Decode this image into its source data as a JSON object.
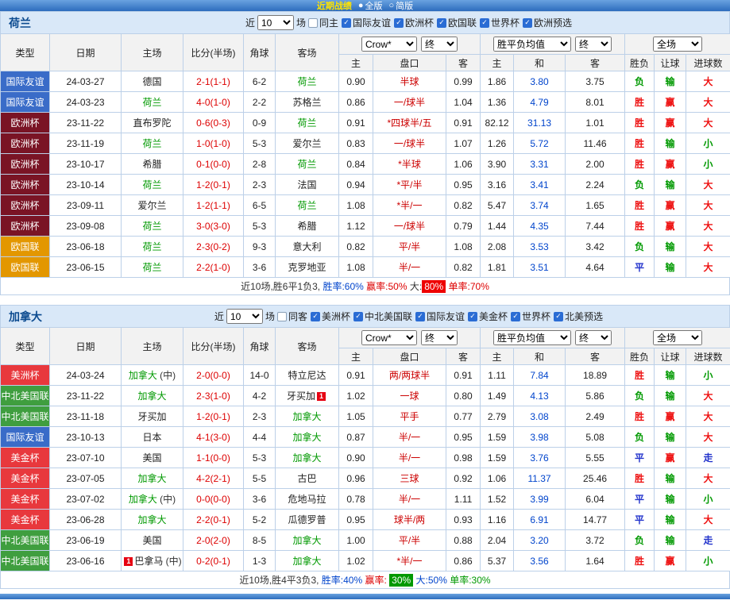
{
  "topbar": {
    "title": "近期战绩",
    "options": [
      {
        "radio": "●",
        "label": "全版"
      },
      {
        "radio": "○",
        "label": "简版"
      }
    ]
  },
  "colors": {
    "league": {
      "国际友谊": "#3a6cc8",
      "欧洲杯": "#7a1425",
      "欧国联": "#e39700",
      "美洲杯": "#e8383d",
      "中北美国联": "#3f9e3f",
      "美金杯": "#e8383d"
    },
    "value": {
      "胜": "#ee1111",
      "平": "#2233cc",
      "负": "#009900",
      "赢": "#ee1111",
      "输": "#009900",
      "走": "#2233cc",
      "大": "#ee1111",
      "小": "#009900"
    }
  },
  "sections": [
    {
      "team": "荷兰",
      "filter": {
        "near_label": "近",
        "count": "10",
        "games_label": "场",
        "checkboxes": [
          {
            "label": "同主",
            "checked": false
          },
          {
            "label": "国际友谊",
            "checked": true
          },
          {
            "label": "欧洲杯",
            "checked": true
          },
          {
            "label": "欧国联",
            "checked": true
          },
          {
            "label": "世界杯",
            "checked": true
          },
          {
            "label": "欧洲预选",
            "checked": true
          }
        ]
      },
      "header": {
        "cols": [
          "类型",
          "日期",
          "主场",
          "比分(半场)",
          "角球",
          "客场"
        ],
        "odds_source": "Crow*",
        "odds_final": "终",
        "avg_source": "胜平负均值",
        "avg_final": "终",
        "scope": "全场",
        "sub": [
          "主",
          "盘口",
          "客",
          "主",
          "和",
          "客",
          "胜负",
          "让球",
          "进球数"
        ]
      },
      "rows": [
        {
          "league": "国际友谊",
          "date": "24-03-27",
          "home": {
            "text": "德国"
          },
          "score": "2-1(1-1)",
          "corner": "6-2",
          "away": {
            "text": "荷兰",
            "green": true
          },
          "odds": [
            "0.90",
            "半球",
            "0.99"
          ],
          "avg": [
            "1.86",
            "3.80",
            "3.75"
          ],
          "result": "负",
          "asian": "输",
          "goals": "大"
        },
        {
          "league": "国际友谊",
          "date": "24-03-23",
          "home": {
            "text": "荷兰",
            "green": true
          },
          "score": "4-0(1-0)",
          "corner": "2-2",
          "away": {
            "text": "苏格兰"
          },
          "odds": [
            "0.86",
            "一/球半",
            "1.04"
          ],
          "avg": [
            "1.36",
            "4.79",
            "8.01"
          ],
          "result": "胜",
          "asian": "赢",
          "goals": "大"
        },
        {
          "league": "欧洲杯",
          "date": "23-11-22",
          "home": {
            "text": "直布罗陀"
          },
          "score": "0-6(0-3)",
          "corner": "0-9",
          "away": {
            "text": "荷兰",
            "green": true
          },
          "odds": [
            "0.91",
            "*四球半/五",
            "0.91"
          ],
          "avg": [
            "82.12",
            "31.13",
            "1.01"
          ],
          "result": "胜",
          "asian": "赢",
          "goals": "大"
        },
        {
          "league": "欧洲杯",
          "date": "23-11-19",
          "home": {
            "text": "荷兰",
            "green": true
          },
          "score": "1-0(1-0)",
          "corner": "5-3",
          "away": {
            "text": "爱尔兰"
          },
          "odds": [
            "0.83",
            "一/球半",
            "1.07"
          ],
          "avg": [
            "1.26",
            "5.72",
            "11.46"
          ],
          "result": "胜",
          "asian": "输",
          "goals": "小"
        },
        {
          "league": "欧洲杯",
          "date": "23-10-17",
          "home": {
            "text": "希腊"
          },
          "score": "0-1(0-0)",
          "corner": "2-8",
          "away": {
            "text": "荷兰",
            "green": true
          },
          "odds": [
            "0.84",
            "*半球",
            "1.06"
          ],
          "avg": [
            "3.90",
            "3.31",
            "2.00"
          ],
          "result": "胜",
          "asian": "赢",
          "goals": "小"
        },
        {
          "league": "欧洲杯",
          "date": "23-10-14",
          "home": {
            "text": "荷兰",
            "green": true
          },
          "score": "1-2(0-1)",
          "corner": "2-3",
          "away": {
            "text": "法国"
          },
          "odds": [
            "0.94",
            "*平/半",
            "0.95"
          ],
          "avg": [
            "3.16",
            "3.41",
            "2.24"
          ],
          "result": "负",
          "asian": "输",
          "goals": "大"
        },
        {
          "league": "欧洲杯",
          "date": "23-09-11",
          "home": {
            "text": "爱尔兰"
          },
          "score": "1-2(1-1)",
          "corner": "6-5",
          "away": {
            "text": "荷兰",
            "green": true
          },
          "odds": [
            "1.08",
            "*半/一",
            "0.82"
          ],
          "avg": [
            "5.47",
            "3.74",
            "1.65"
          ],
          "result": "胜",
          "asian": "赢",
          "goals": "大"
        },
        {
          "league": "欧洲杯",
          "date": "23-09-08",
          "home": {
            "text": "荷兰",
            "green": true
          },
          "score": "3-0(3-0)",
          "corner": "5-3",
          "away": {
            "text": "希腊"
          },
          "odds": [
            "1.12",
            "一/球半",
            "0.79"
          ],
          "avg": [
            "1.44",
            "4.35",
            "7.44"
          ],
          "result": "胜",
          "asian": "赢",
          "goals": "大"
        },
        {
          "league": "欧国联",
          "date": "23-06-18",
          "home": {
            "text": "荷兰",
            "green": true
          },
          "score": "2-3(0-2)",
          "corner": "9-3",
          "away": {
            "text": "意大利"
          },
          "odds": [
            "0.82",
            "平/半",
            "1.08"
          ],
          "avg": [
            "2.08",
            "3.53",
            "3.42"
          ],
          "result": "负",
          "asian": "输",
          "goals": "大"
        },
        {
          "league": "欧国联",
          "date": "23-06-15",
          "home": {
            "text": "荷兰",
            "green": true
          },
          "score": "2-2(1-0)",
          "corner": "3-6",
          "away": {
            "text": "克罗地亚"
          },
          "odds": [
            "1.08",
            "半/一",
            "0.82"
          ],
          "avg": [
            "1.81",
            "3.51",
            "4.64"
          ],
          "result": "平",
          "asian": "输",
          "goals": "大"
        }
      ],
      "summary": [
        {
          "text": "近10场,胜6平1负3, ",
          "color": "#333333"
        },
        {
          "text": "胜率:60% ",
          "color": "#0044cc"
        },
        {
          "text": "赢率:50% ",
          "color": "#dd0000"
        },
        {
          "text": "大:",
          "color": "#333333"
        },
        {
          "text": "80%",
          "color": "#ffffff",
          "bg": "#ee0000"
        },
        {
          "text": " 单率:70%",
          "color": "#dd0000"
        }
      ]
    },
    {
      "team": "加拿大",
      "filter": {
        "near_label": "近",
        "count": "10",
        "games_label": "场",
        "checkboxes": [
          {
            "label": "同客",
            "checked": false
          },
          {
            "label": "美洲杯",
            "checked": true
          },
          {
            "label": "中北美国联",
            "checked": true
          },
          {
            "label": "国际友谊",
            "checked": true
          },
          {
            "label": "美金杯",
            "checked": true
          },
          {
            "label": "世界杯",
            "checked": true
          },
          {
            "label": "北美预选",
            "checked": true
          }
        ]
      },
      "header": {
        "cols": [
          "类型",
          "日期",
          "主场",
          "比分(半场)",
          "角球",
          "客场"
        ],
        "odds_source": "Crow*",
        "odds_final": "终",
        "avg_source": "胜平负均值",
        "avg_final": "终",
        "scope": "全场",
        "sub": [
          "主",
          "盘口",
          "客",
          "主",
          "和",
          "客",
          "胜负",
          "让球",
          "进球数"
        ]
      },
      "rows": [
        {
          "league": "美洲杯",
          "date": "24-03-24",
          "home": {
            "text": "加拿大",
            "suffix": "(中)",
            "green": true
          },
          "score": "2-0(0-0)",
          "corner": "14-0",
          "away": {
            "text": "特立尼达"
          },
          "odds": [
            "0.91",
            "两/两球半",
            "0.91"
          ],
          "avg": [
            "1.11",
            "7.84",
            "18.89"
          ],
          "result": "胜",
          "asian": "输",
          "goals": "小"
        },
        {
          "league": "中北美国联",
          "date": "23-11-22",
          "home": {
            "text": "加拿大",
            "green": true
          },
          "score": "2-3(1-0)",
          "corner": "4-2",
          "away": {
            "text": "牙买加",
            "badge": "1",
            "badge_pos": "after"
          },
          "odds": [
            "1.02",
            "一球",
            "0.80"
          ],
          "avg": [
            "1.49",
            "4.13",
            "5.86"
          ],
          "result": "负",
          "asian": "输",
          "goals": "大"
        },
        {
          "league": "中北美国联",
          "date": "23-11-18",
          "home": {
            "text": "牙买加"
          },
          "score": "1-2(0-1)",
          "corner": "2-3",
          "away": {
            "text": "加拿大",
            "green": true
          },
          "odds": [
            "1.05",
            "平手",
            "0.77"
          ],
          "avg": [
            "2.79",
            "3.08",
            "2.49"
          ],
          "result": "胜",
          "asian": "赢",
          "goals": "大"
        },
        {
          "league": "国际友谊",
          "date": "23-10-13",
          "home": {
            "text": "日本"
          },
          "score": "4-1(3-0)",
          "corner": "4-4",
          "away": {
            "text": "加拿大",
            "green": true
          },
          "odds": [
            "0.87",
            "半/一",
            "0.95"
          ],
          "avg": [
            "1.59",
            "3.98",
            "5.08"
          ],
          "result": "负",
          "asian": "输",
          "goals": "大"
        },
        {
          "league": "美金杯",
          "date": "23-07-10",
          "home": {
            "text": "美国"
          },
          "score": "1-1(0-0)",
          "corner": "5-3",
          "away": {
            "text": "加拿大",
            "green": true
          },
          "odds": [
            "0.90",
            "半/一",
            "0.98"
          ],
          "avg": [
            "1.59",
            "3.76",
            "5.55"
          ],
          "result": "平",
          "asian": "赢",
          "goals": "走"
        },
        {
          "league": "美金杯",
          "date": "23-07-05",
          "home": {
            "text": "加拿大",
            "green": true
          },
          "score": "4-2(2-1)",
          "corner": "5-5",
          "away": {
            "text": "古巴"
          },
          "odds": [
            "0.96",
            "三球",
            "0.92"
          ],
          "avg": [
            "1.06",
            "11.37",
            "25.46"
          ],
          "result": "胜",
          "asian": "输",
          "goals": "大"
        },
        {
          "league": "美金杯",
          "date": "23-07-02",
          "home": {
            "text": "加拿大",
            "suffix": "(中)",
            "green": true
          },
          "score": "0-0(0-0)",
          "corner": "3-6",
          "away": {
            "text": "危地马拉"
          },
          "odds": [
            "0.78",
            "半/一",
            "1.11"
          ],
          "avg": [
            "1.52",
            "3.99",
            "6.04"
          ],
          "result": "平",
          "asian": "输",
          "goals": "小"
        },
        {
          "league": "美金杯",
          "date": "23-06-28",
          "home": {
            "text": "加拿大",
            "green": true
          },
          "score": "2-2(0-1)",
          "corner": "5-2",
          "away": {
            "text": "瓜德罗普"
          },
          "odds": [
            "0.95",
            "球半/两",
            "0.93"
          ],
          "avg": [
            "1.16",
            "6.91",
            "14.77"
          ],
          "result": "平",
          "asian": "输",
          "goals": "大"
        },
        {
          "league": "中北美国联",
          "date": "23-06-19",
          "home": {
            "text": "美国"
          },
          "score": "2-0(2-0)",
          "corner": "8-5",
          "away": {
            "text": "加拿大",
            "green": true
          },
          "odds": [
            "1.00",
            "平/半",
            "0.88"
          ],
          "avg": [
            "2.04",
            "3.20",
            "3.72"
          ],
          "result": "负",
          "asian": "输",
          "goals": "走"
        },
        {
          "league": "中北美国联",
          "date": "23-06-16",
          "home": {
            "text": "巴拿马",
            "suffix": "(中)",
            "badge": "1",
            "badge_pos": "before"
          },
          "score": "0-2(0-1)",
          "corner": "1-3",
          "away": {
            "text": "加拿大",
            "green": true
          },
          "odds": [
            "1.02",
            "*半/一",
            "0.86"
          ],
          "avg": [
            "5.37",
            "3.56",
            "1.64"
          ],
          "result": "胜",
          "asian": "赢",
          "goals": "小"
        }
      ],
      "summary": [
        {
          "text": "近10场,胜4平3负3, ",
          "color": "#333333"
        },
        {
          "text": "胜率:40% ",
          "color": "#0044cc"
        },
        {
          "text": "赢率: ",
          "color": "#dd0000"
        },
        {
          "text": "30%",
          "color": "#ffffff",
          "bg": "#009900"
        },
        {
          "text": " 大:50% ",
          "color": "#0044cc"
        },
        {
          "text": "单率:30%",
          "color": "#009900"
        }
      ]
    }
  ]
}
